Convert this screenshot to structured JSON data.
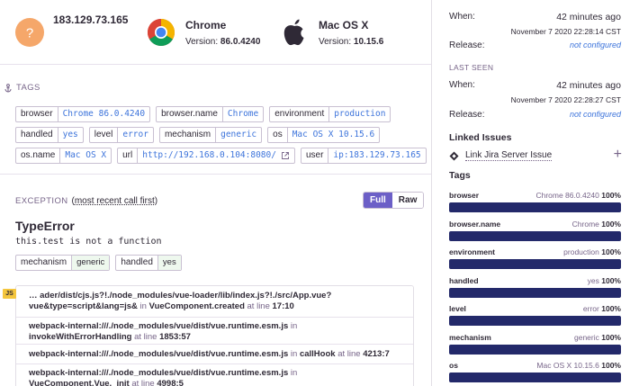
{
  "context": {
    "ip": "183.129.73.165",
    "browser": {
      "name": "Chrome",
      "version_label": "Version:",
      "version": "86.0.4240"
    },
    "os": {
      "name": "Mac OS X",
      "version_label": "Version:",
      "version": "10.15.6"
    }
  },
  "tags_section": {
    "heading": "Tags",
    "tags": [
      {
        "key": "browser",
        "value": "Chrome 86.0.4240"
      },
      {
        "key": "browser.name",
        "value": "Chrome"
      },
      {
        "key": "environment",
        "value": "production"
      },
      {
        "key": "handled",
        "value": "yes"
      },
      {
        "key": "level",
        "value": "error"
      },
      {
        "key": "mechanism",
        "value": "generic"
      },
      {
        "key": "os",
        "value": "Mac OS X 10.15.6"
      },
      {
        "key": "os.name",
        "value": "Mac OS X"
      },
      {
        "key": "url",
        "value": "http://192.168.0.104:8080/"
      },
      {
        "key": "user",
        "value": "ip:183.129.73.165"
      }
    ]
  },
  "exception": {
    "heading": "Exception",
    "order_link": "most recent call first",
    "full_label": "Full",
    "raw_label": "Raw",
    "type": "TypeError",
    "message": "this.test is not a function",
    "mechanism": {
      "key": "mechanism",
      "value": "generic"
    },
    "handled": {
      "key": "handled",
      "value": "yes"
    },
    "language_badge": "JS",
    "frames": [
      {
        "file": "… ader/dist/cjs.js?!./node_modules/vue-loader/lib/index.js?!./src/App.vue?vue&type=script&lang=js&",
        "in_word": "in",
        "func": "VueComponent.created",
        "at_word": "at line",
        "line": "17:10"
      },
      {
        "file": "webpack-internal:///./node_modules/vue/dist/vue.runtime.esm.js",
        "in_word": "in",
        "func": "invokeWithErrorHandling",
        "at_word": "at line",
        "line": "1853:57"
      },
      {
        "file": "webpack-internal:///./node_modules/vue/dist/vue.runtime.esm.js",
        "in_word": "in",
        "func": "callHook",
        "at_word": "at line",
        "line": "4213:7"
      },
      {
        "file": "webpack-internal:///./node_modules/vue/dist/vue.runtime.esm.js",
        "in_word": "in",
        "func": "VueComponent.Vue._init",
        "at_word": "at line",
        "line": "4998:5"
      }
    ]
  },
  "sidebar": {
    "first_seen": {
      "when_label": "When:",
      "when": "42 minutes ago",
      "timestamp": "November 7 2020 22:28:14 CST",
      "release_label": "Release:",
      "release": "not configured"
    },
    "last_seen": {
      "heading": "Last Seen",
      "when_label": "When:",
      "when": "42 minutes ago",
      "timestamp": "November 7 2020 22:28:27 CST",
      "release_label": "Release:",
      "release": "not configured"
    },
    "linked_issues": {
      "heading": "Linked Issues",
      "jira_label": "Link Jira Server Issue",
      "add_symbol": "+"
    },
    "tags": {
      "heading": "Tags",
      "items": [
        {
          "key": "browser",
          "top_value": "Chrome 86.0.4240",
          "percent_label": "100%",
          "percent": 100
        },
        {
          "key": "browser.name",
          "top_value": "Chrome",
          "percent_label": "100%",
          "percent": 100
        },
        {
          "key": "environment",
          "top_value": "production",
          "percent_label": "100%",
          "percent": 100
        },
        {
          "key": "handled",
          "top_value": "yes",
          "percent_label": "100%",
          "percent": 100
        },
        {
          "key": "level",
          "top_value": "error",
          "percent_label": "100%",
          "percent": 100
        },
        {
          "key": "mechanism",
          "top_value": "generic",
          "percent_label": "100%",
          "percent": 100
        },
        {
          "key": "os",
          "top_value": "Mac OS X 10.15.6",
          "percent_label": "100%",
          "percent": 100
        }
      ]
    }
  },
  "colors": {
    "accent": "#6c5fc7",
    "link": "#3d74db",
    "bar": "#23296a",
    "avatar": "#f5a76a"
  }
}
